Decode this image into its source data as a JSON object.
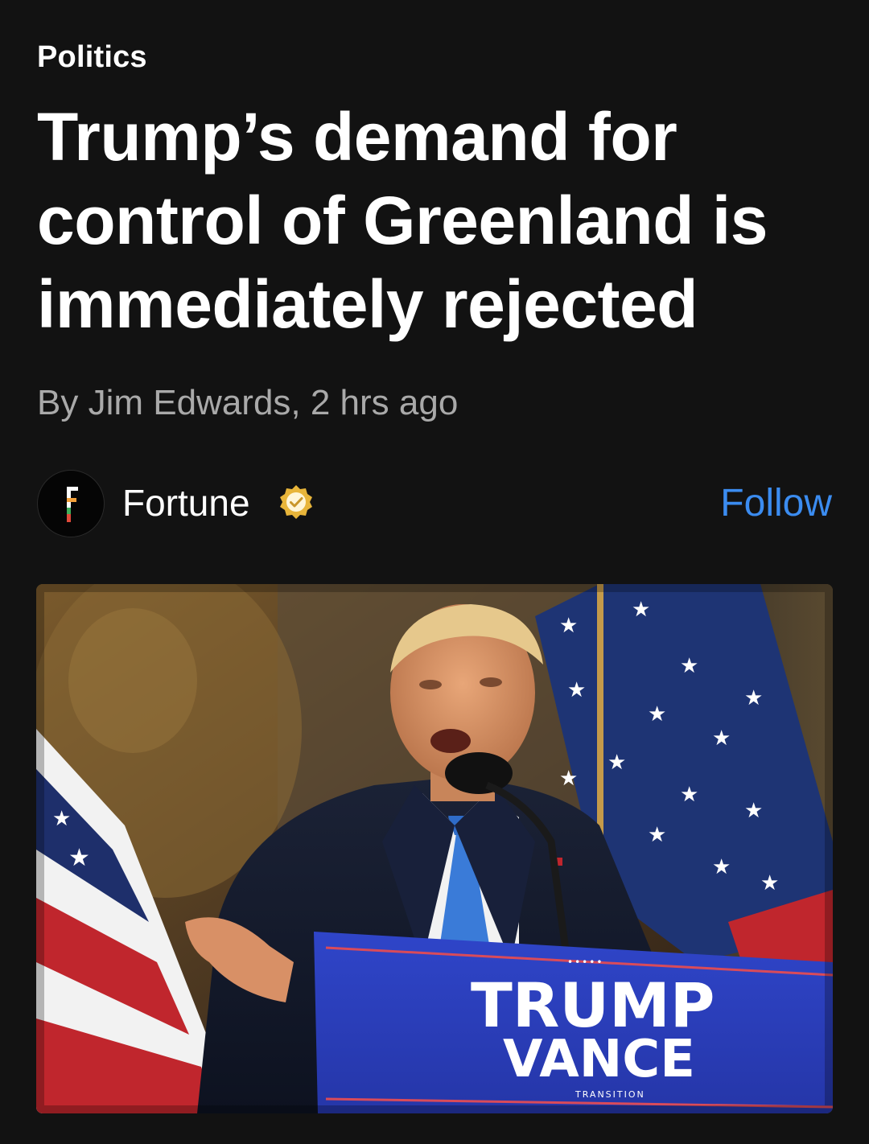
{
  "article": {
    "category": "Politics",
    "headline": "Trump’s demand for control of Greenland is immediately rejected",
    "byline": "By Jim Edwards, 2 hrs ago"
  },
  "source": {
    "name": "Fortune",
    "logo_letter": "F",
    "verified": true,
    "follow_label": "Follow"
  },
  "hero_image": {
    "podium_line1": "TRUMP",
    "podium_line2": "VANCE",
    "podium_small": "TRANSITION"
  },
  "colors": {
    "background": "#121212",
    "accent": "#3b8cf0",
    "byline": "#a9a9a9",
    "verified_badge": "#e8b53a"
  }
}
